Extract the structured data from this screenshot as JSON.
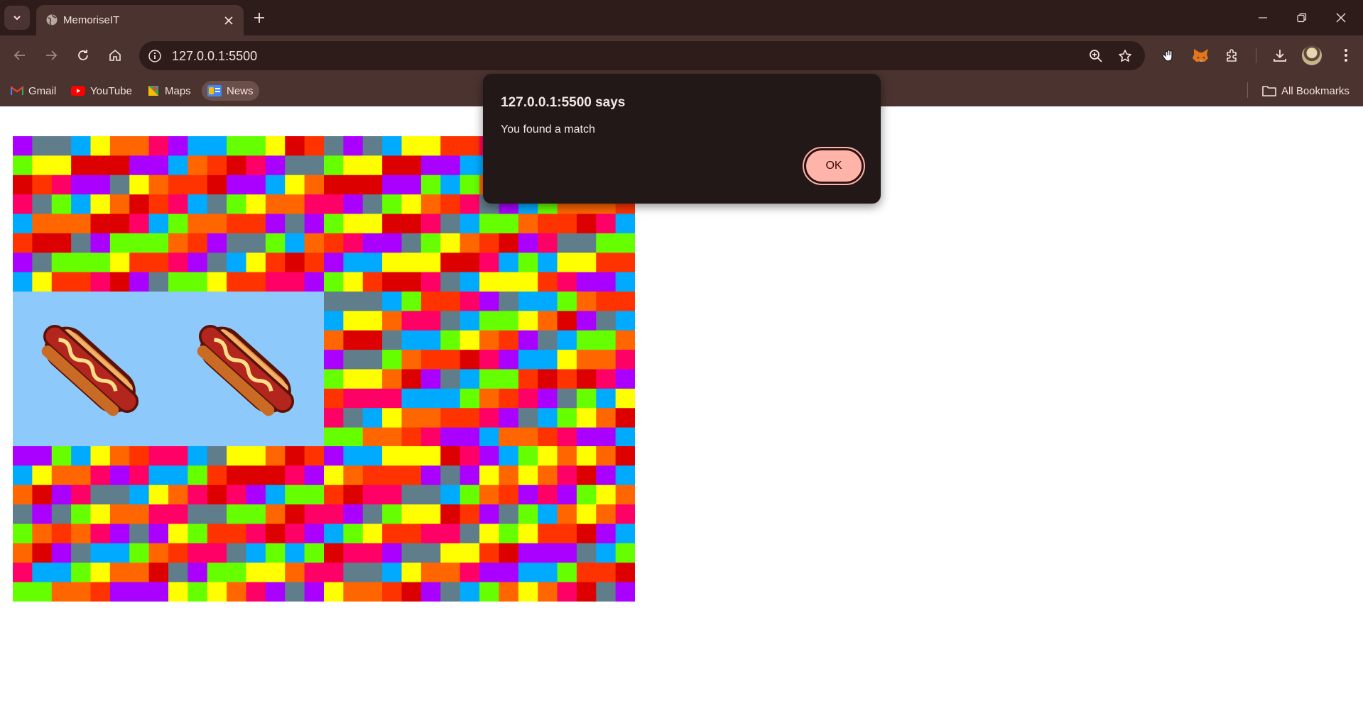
{
  "browser": {
    "tab_title": "MemoriseIT",
    "url": "127.0.0.1:5500",
    "theme_color": "#4b3330"
  },
  "bookmarks": {
    "items": [
      {
        "label": "Gmail",
        "icon": "gmail-icon"
      },
      {
        "label": "YouTube",
        "icon": "youtube-icon"
      },
      {
        "label": "Maps",
        "icon": "maps-icon"
      },
      {
        "label": "News",
        "icon": "news-icon"
      }
    ],
    "all_bookmarks": "All Bookmarks"
  },
  "game": {
    "rows": 3,
    "cols": 4,
    "card_back_colors": [
      "#ff0066",
      "#aa00ff",
      "#607d8b",
      "#00aaff",
      "#66ff00",
      "#ffff00",
      "#ff6600",
      "#ff3300",
      "#dd0000"
    ],
    "face_up_color": "#8ec9fb",
    "face_up_cards": [
      "hotdog",
      "hotdog"
    ]
  },
  "dialog": {
    "title": "127.0.0.1:5500 says",
    "message": "You found a match",
    "ok_label": "OK"
  }
}
